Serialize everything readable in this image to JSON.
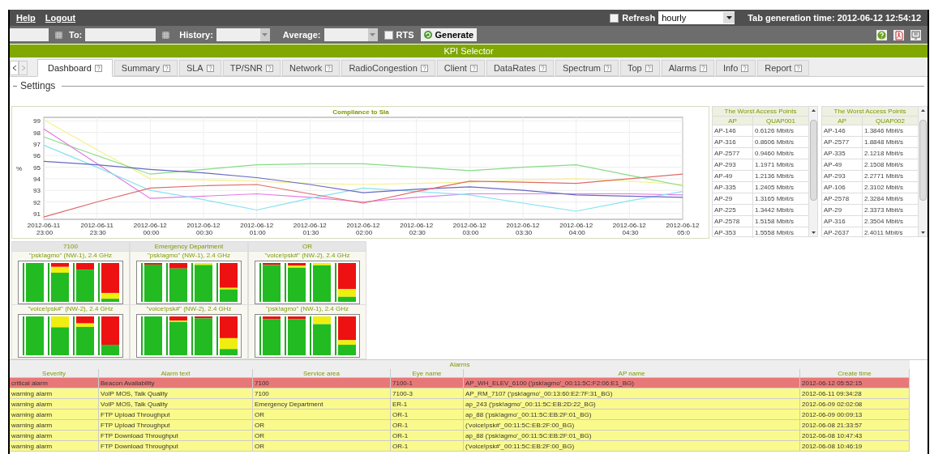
{
  "top_bar": {
    "links": [
      "Help",
      "Logout"
    ],
    "refresh": {
      "label": "Refresh",
      "checked": false
    },
    "refresh_select": {
      "value": "hourly"
    },
    "generation_time": "Tab generation time: 2012-06-12 12:54:12"
  },
  "toolbar": {
    "to_label": "To:",
    "history_label": "History:",
    "average_label": "Average:",
    "rts": {
      "label": "RTS",
      "checked": false
    },
    "generate_button": "Generate"
  },
  "header": "KPI Selector",
  "tabs": [
    {
      "label": "Dashboard",
      "selected": true
    },
    {
      "label": "Summary",
      "selected": false
    },
    {
      "label": "SLA",
      "selected": false
    },
    {
      "label": "TP/SNR",
      "selected": false
    },
    {
      "label": "Network",
      "selected": false
    },
    {
      "label": "RadioCongestion",
      "selected": false
    },
    {
      "label": "Client",
      "selected": false
    },
    {
      "label": "DataRates",
      "selected": false
    },
    {
      "label": "Spectrum",
      "selected": false
    },
    {
      "label": "Top",
      "selected": false
    },
    {
      "label": "Alarms",
      "selected": false
    },
    {
      "label": "Info",
      "selected": false
    },
    {
      "label": "Report",
      "selected": false
    }
  ],
  "section_title": "Settings",
  "chart": {
    "chart_data": {
      "type": "line",
      "grid": true,
      "title": "Compliance to Sla",
      "ylabel": "%",
      "categories": [
        "2012-06-11 23:00",
        "2012-06-11 23:30",
        "2012-06-12 00:00",
        "2012-06-12 00:30",
        "2012-06-12 01:00",
        "2012-06-12 01:30",
        "2012-06-12 02:00",
        "2012-06-12 02:30",
        "2012-06-12 03:00",
        "2012-06-12 03:30",
        "2012-06-12 04:00",
        "2012-06-12 04:30",
        "2012-06-12 05:0"
      ],
      "ylim": [
        90.5,
        99.3
      ],
      "yticks": [
        91,
        92,
        93,
        94,
        95,
        96,
        97,
        98,
        99
      ],
      "series": [
        {
          "color": "#f2f28c",
          "values": [
            99.1,
            96.5,
            94.0,
            93.9,
            93.8,
            93.6,
            93.5,
            93.6,
            93.7,
            93.9,
            94.0,
            93.8,
            93.5
          ]
        },
        {
          "color": "#86dc86",
          "values": [
            97.6,
            96.0,
            94.4,
            94.8,
            95.2,
            95.3,
            95.3,
            95.0,
            94.7,
            95.0,
            95.2,
            94.3,
            93.4
          ]
        },
        {
          "color": "#e27ae2",
          "values": [
            98.3,
            95.3,
            92.3,
            92.5,
            92.7,
            92.4,
            92.0,
            92.4,
            92.7,
            92.7,
            92.7,
            92.7,
            92.6
          ]
        },
        {
          "color": "#86e2f0",
          "values": [
            96.9,
            95.0,
            93.0,
            92.2,
            91.3,
            92.3,
            93.2,
            92.9,
            92.6,
            91.9,
            91.2,
            92.1,
            92.9
          ]
        },
        {
          "color": "#6868c4",
          "values": [
            95.5,
            95.2,
            94.8,
            94.5,
            94.1,
            93.5,
            92.8,
            93.1,
            93.3,
            93.0,
            92.6,
            92.5,
            92.4
          ]
        },
        {
          "color": "#e06a6a",
          "values": [
            90.7,
            92.0,
            93.2,
            93.4,
            93.5,
            92.7,
            91.9,
            92.9,
            93.8,
            93.7,
            93.6,
            94.0,
            94.4
          ]
        }
      ]
    }
  },
  "worst_tables": [
    {
      "title": "The Worst Access Points",
      "columns": [
        "AP",
        "QUAP001"
      ],
      "rows": [
        [
          "AP-146",
          "0.6126 Mbit/s"
        ],
        [
          "AP-316",
          "0.8606 Mbit/s"
        ],
        [
          "AP-2577",
          "0.9460 Mbit/s"
        ],
        [
          "AP-293",
          "1.1971 Mbit/s"
        ],
        [
          "AP-49",
          "1.2136 Mbit/s"
        ],
        [
          "AP-335",
          "1.2405 Mbit/s"
        ],
        [
          "AP-29",
          "1.3165 Mbit/s"
        ],
        [
          "AP-225",
          "1.3442 Mbit/s"
        ],
        [
          "AP-2578",
          "1.5158 Mbit/s"
        ],
        [
          "AP-353",
          "1.5558 Mbit/s"
        ]
      ]
    },
    {
      "title": "The Worst Access Points",
      "columns": [
        "AP",
        "QUAP002"
      ],
      "rows": [
        [
          "AP-146",
          "1.3846 Mbit/s"
        ],
        [
          "AP-2577",
          "1.8848 Mbit/s"
        ],
        [
          "AP-335",
          "2.1218 Mbit/s"
        ],
        [
          "AP-49",
          "2.1508 Mbit/s"
        ],
        [
          "AP-293",
          "2.2771 Mbit/s"
        ],
        [
          "AP-106",
          "2.3102 Mbit/s"
        ],
        [
          "AP-2578",
          "2.3284 Mbit/s"
        ],
        [
          "AP-29",
          "2.3373 Mbit/s"
        ],
        [
          "AP-316",
          "2.3504 Mbit/s"
        ],
        [
          "AP-2637",
          "2.4011 Mbit/s"
        ]
      ]
    }
  ],
  "panels": [
    {
      "title": "7100",
      "subtitles": [
        "\"psk!agmo\" (NW-1), 2.4 GHz",
        "\"voice!psk#\" (NW-2), 2.4 GHz"
      ]
    },
    {
      "title": "Emergency Department",
      "subtitles": [
        "\"psk!agmo\" (NW-1), 2.4 GHz",
        "\"voice!psk#\" (NW-2), 2.4 GHz"
      ]
    },
    {
      "title": "OR",
      "subtitles": [
        "\"voice!psk#\" (NW-2), 2.4 GHz",
        "\"psk!agmo\" (NW-1), 2.4 GHz"
      ]
    }
  ],
  "alarms": {
    "title": "Alarms",
    "columns": [
      "Severity",
      "Alarm text",
      "Service area",
      "Eye name",
      "AP name",
      "Create time"
    ],
    "rows": [
      {
        "color": "#e87878",
        "cells": [
          "critical alarm",
          "Beacon Availability",
          "7100",
          "7100-1",
          "AP_WH_ELEV_6100 ('psk!agmo'_00:11:5C:F2:06:E1_BG)",
          "2012-06-12 05:52:15"
        ]
      },
      {
        "color": "#fafa8c",
        "cells": [
          "warning alarm",
          "VoIP MOS, Talk Quality",
          "7100",
          "7100-3",
          "AP_RM_7107 ('psk!agmo'_00:13:60:E2:7F:31_BG)",
          "2012-06-11 09:34:28"
        ]
      },
      {
        "color": "#fafa8c",
        "cells": [
          "warning alarm",
          "VoIP MOS, Talk Quality",
          "Emergency Department",
          "ER-1",
          "ap_243 ('psk!agmo'_00:11:5C:EB:2D:22_BG)",
          "2012-06-09 02:02:08"
        ]
      },
      {
        "color": "#fafa8c",
        "cells": [
          "warning alarm",
          "FTP Upload Throughput",
          "OR",
          "OR-1",
          "ap_88 ('psk!agmo'_00:11:5C:EB:2F:01_BG)",
          "2012-06-09 00:09:13"
        ]
      },
      {
        "color": "#fafa8c",
        "cells": [
          "warning alarm",
          "FTP Upload Throughput",
          "OR",
          "OR-1",
          "('voice!psk#'_00:11:5C:EB:2F:00_BG)",
          "2012-06-08 21:33:57"
        ]
      },
      {
        "color": "#fafa8c",
        "cells": [
          "warning alarm",
          "FTP Download Throughput",
          "OR",
          "OR-1",
          "ap_88 ('psk!agmo'_00:11:5C:EB:2F:01_BG)",
          "2012-06-08 10:47:43"
        ]
      },
      {
        "color": "#fafa8c",
        "cells": [
          "warning alarm",
          "FTP Download Throughput",
          "OR",
          "OR-1",
          "('voice!psk#'_00:11:5C:EB:2F:00_BG)",
          "2012-06-08 10:46:19"
        ]
      }
    ]
  }
}
